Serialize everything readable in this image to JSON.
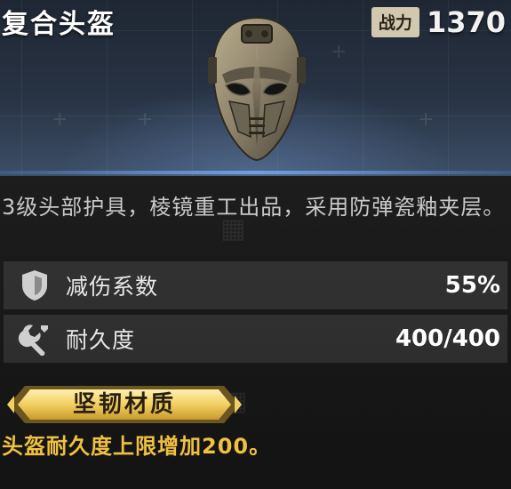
{
  "item": {
    "name": "复合头盔",
    "power_label": "战力",
    "power_value": "1370",
    "description": "3级头部护具，棱镜重工出品，采用防弹瓷釉夹层。"
  },
  "stats": [
    {
      "icon": "shield-icon",
      "label": "减伤系数",
      "value": "55%"
    },
    {
      "icon": "wrench-icon",
      "label": "耐久度",
      "value": "400/400"
    }
  ],
  "perk": {
    "name": "坚韧材质",
    "description": "头盔耐久度上限增加200。"
  },
  "colors": {
    "perk_text": "#f0c040",
    "power_badge": "#d2c8b0",
    "header_accent": "#6f9fe0"
  }
}
